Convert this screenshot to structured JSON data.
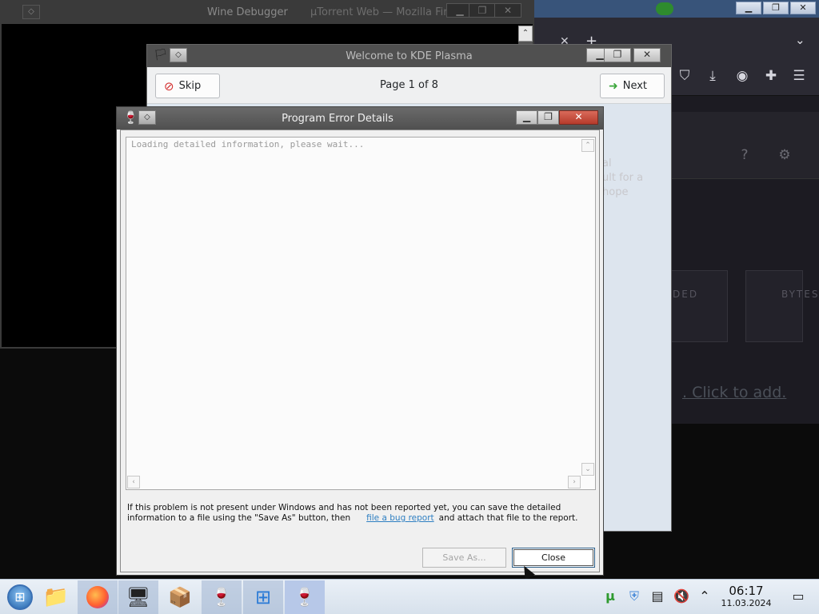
{
  "firefox": {
    "page_title": "µTorrent Web — Mozilla Firefox",
    "text_line1": "al",
    "text_line2": "ult for a",
    "text_line3": "hope",
    "card_label_1": "DED",
    "card_label_2": "BYTES",
    "click_to_add": ". Click to add."
  },
  "wine_debugger": {
    "title": "Wine Debugger"
  },
  "kde_welcome": {
    "title": "Welcome to KDE Plasma",
    "skip_label": "Skip",
    "next_label": "Next",
    "page_indicator": "Page 1 of 8"
  },
  "error_dialog": {
    "title": "Program Error Details",
    "loading_text": "Loading detailed information, please wait...",
    "info_line1": "If this problem is not present under Windows and has not been reported yet, you can save the detailed",
    "info_line2_a": "information to a file using the \"Save As\" button, then",
    "link_text": "file a bug report",
    "info_line2_b": "and attach that file to the report.",
    "save_as_label": "Save As...",
    "close_label": "Close"
  },
  "taskbar": {
    "clock_time": "06:17",
    "clock_date": "11.03.2024",
    "apps": [
      {
        "name": "start-menu",
        "icon": "windows-logo"
      },
      {
        "name": "file-manager",
        "icon": "folder-icon"
      },
      {
        "name": "firefox",
        "icon": "firefox-icon"
      },
      {
        "name": "control-panel",
        "icon": "monitor-icon"
      },
      {
        "name": "package",
        "icon": "package-icon"
      },
      {
        "name": "wine-1",
        "icon": "wine-glass-icon"
      },
      {
        "name": "windows-app",
        "icon": "windows-flag-icon"
      },
      {
        "name": "wine-2",
        "icon": "wine-glass-icon"
      }
    ]
  },
  "colors": {
    "accent_blue": "#2e7fc2",
    "titlebar_dark": "#505050",
    "taskbar_bg": "#dde6f0"
  }
}
